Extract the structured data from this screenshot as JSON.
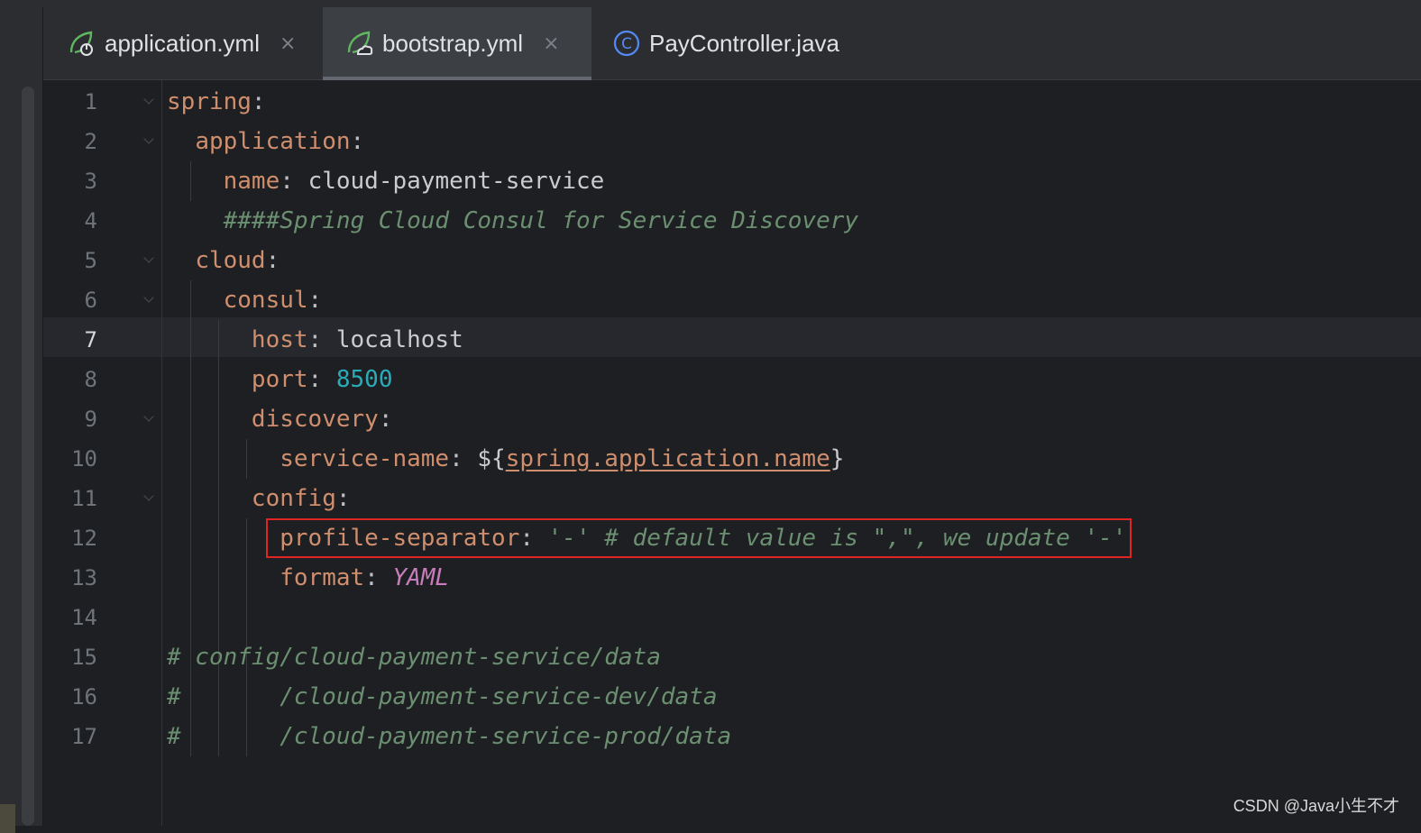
{
  "tabs": [
    {
      "label": "application.yml",
      "icon": "spring-boot-leaf-power-icon",
      "close": "×",
      "active": false
    },
    {
      "label": "bootstrap.yml",
      "icon": "spring-cloud-leaf-icon",
      "close": "×",
      "active": true
    },
    {
      "label": "PayController.java",
      "icon": "java-class-c-icon",
      "close": "",
      "active": false
    }
  ],
  "editor": {
    "current_line": 7,
    "line_numbers": [
      "1",
      "2",
      "3",
      "4",
      "5",
      "6",
      "7",
      "8",
      "9",
      "10",
      "11",
      "12",
      "13",
      "14",
      "15",
      "16",
      "17"
    ],
    "lines": [
      {
        "segments": [
          {
            "t": "spring",
            "c": "key"
          },
          {
            "t": ":",
            "c": "punct"
          }
        ]
      },
      {
        "segments": [
          {
            "t": "  "
          },
          {
            "t": "application",
            "c": "key"
          },
          {
            "t": ":",
            "c": "punct"
          }
        ]
      },
      {
        "segments": [
          {
            "t": "    "
          },
          {
            "t": "name",
            "c": "key"
          },
          {
            "t": ": ",
            "c": "punct"
          },
          {
            "t": "cloud-payment-service",
            "c": "value"
          }
        ]
      },
      {
        "segments": [
          {
            "t": "    "
          },
          {
            "t": "####Spring Cloud Consul for Service Discovery",
            "c": "comment"
          }
        ]
      },
      {
        "segments": [
          {
            "t": "  "
          },
          {
            "t": "cloud",
            "c": "key"
          },
          {
            "t": ":",
            "c": "punct"
          }
        ]
      },
      {
        "segments": [
          {
            "t": "    "
          },
          {
            "t": "consul",
            "c": "key"
          },
          {
            "t": ":",
            "c": "punct"
          }
        ]
      },
      {
        "segments": [
          {
            "t": "      "
          },
          {
            "t": "host",
            "c": "key"
          },
          {
            "t": ": ",
            "c": "punct"
          },
          {
            "t": "localhost",
            "c": "value"
          }
        ]
      },
      {
        "segments": [
          {
            "t": "      "
          },
          {
            "t": "port",
            "c": "key"
          },
          {
            "t": ": ",
            "c": "punct"
          },
          {
            "t": "8500",
            "c": "number"
          }
        ]
      },
      {
        "segments": [
          {
            "t": "      "
          },
          {
            "t": "discovery",
            "c": "key"
          },
          {
            "t": ":",
            "c": "punct"
          }
        ]
      },
      {
        "segments": [
          {
            "t": "        "
          },
          {
            "t": "service-name",
            "c": "key"
          },
          {
            "t": ": ",
            "c": "punct"
          },
          {
            "t": "${",
            "c": "value"
          },
          {
            "t": "spring.application.name",
            "c": "ref"
          },
          {
            "t": "}",
            "c": "value"
          }
        ]
      },
      {
        "segments": [
          {
            "t": "      "
          },
          {
            "t": "config",
            "c": "key"
          },
          {
            "t": ":",
            "c": "punct"
          }
        ]
      },
      {
        "segments": [
          {
            "t": "        "
          },
          {
            "t": "profile-separator",
            "c": "key"
          },
          {
            "t": ": ",
            "c": "punct"
          },
          {
            "t": "'-' # default value is \",\", we update '-'",
            "c": "comment"
          }
        ]
      },
      {
        "segments": [
          {
            "t": "        "
          },
          {
            "t": "format",
            "c": "key"
          },
          {
            "t": ": ",
            "c": "punct"
          },
          {
            "t": "YAML",
            "c": "enum"
          }
        ]
      },
      {
        "segments": []
      },
      {
        "segments": [
          {
            "t": "# config/cloud-payment-service/data",
            "c": "comment"
          }
        ]
      },
      {
        "segments": [
          {
            "t": "#       /cloud-payment-service-dev/data",
            "c": "comment"
          }
        ]
      },
      {
        "segments": [
          {
            "t": "#       /cloud-payment-service-prod/data",
            "c": "comment"
          }
        ]
      }
    ],
    "fold_lines": [
      1,
      2,
      5,
      6,
      9,
      11
    ]
  },
  "watermark": "CSDN @Java小生不才",
  "colors": {
    "background": "#1e1f22",
    "key": "#cf8e6d",
    "comment": "#6b8f71",
    "number": "#2aacb8",
    "enum": "#c77dbb",
    "highlight_box": "#e02424"
  }
}
